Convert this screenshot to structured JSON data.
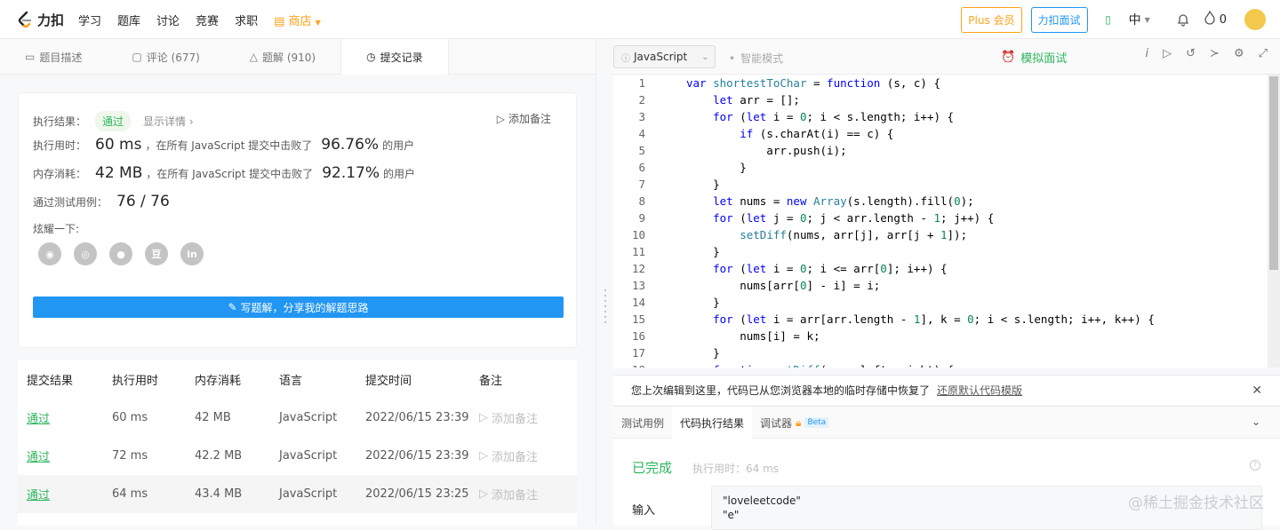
{
  "topbar": {
    "logo": "力扣",
    "nav": [
      "学习",
      "题库",
      "讨论",
      "竞赛",
      "求职"
    ],
    "shop": "商店",
    "plus_button": "Plus 会员",
    "interview_button": "力扣面试",
    "lang_switch": "中",
    "points": "0"
  },
  "left_tabs": [
    {
      "label": "题目描述"
    },
    {
      "label": "评论 (677)"
    },
    {
      "label": "题解 (910)"
    },
    {
      "label": "提交记录"
    }
  ],
  "result": {
    "label_result": "执行结果：",
    "status": "通过",
    "show_details": "显示详情",
    "add_note": "添加备注",
    "label_time": "执行用时：",
    "time_value": "60 ms",
    "time_desc": "，在所有 JavaScript 提交中击败了",
    "time_pct": "96.76%",
    "users_suffix": "的用户",
    "label_memory": "内存消耗：",
    "memory_value": "42 MB",
    "memory_desc": "，在所有 JavaScript 提交中击败了",
    "memory_pct": "92.17%",
    "label_tests": "通过测试用例：",
    "tests_value": "76 / 76",
    "share_label": "炫耀一下:",
    "write_solution": "写题解，分享我的解题思路"
  },
  "table": {
    "headers": [
      "提交结果",
      "执行用时",
      "内存消耗",
      "语言",
      "提交时间",
      "备注"
    ],
    "rows": [
      {
        "status": "通过",
        "time": "60 ms",
        "memory": "42 MB",
        "lang": "JavaScript",
        "date": "2022/06/15 23:39",
        "note": "添加备注"
      },
      {
        "status": "通过",
        "time": "72 ms",
        "memory": "42.2 MB",
        "lang": "JavaScript",
        "date": "2022/06/15 23:39",
        "note": "添加备注"
      },
      {
        "status": "通过",
        "time": "64 ms",
        "memory": "43.4 MB",
        "lang": "JavaScript",
        "date": "2022/06/15 23:25",
        "note": "添加备注"
      }
    ]
  },
  "editor": {
    "language": "JavaScript",
    "smart_mode": "智能模式",
    "mock_interview": "模拟面试",
    "lines": [
      "var shortestToChar = function (s, c) {",
      "    let arr = [];",
      "    for (let i = 0; i < s.length; i++) {",
      "        if (s.charAt(i) == c) {",
      "            arr.push(i);",
      "        }",
      "    }",
      "    let nums = new Array(s.length).fill(0);",
      "    for (let j = 0; j < arr.length - 1; j++) {",
      "        setDiff(nums, arr[j], arr[j + 1]);",
      "    }",
      "    for (let i = 0; i <= arr[0]; i++) {",
      "        nums[arr[0] - i] = i;",
      "    }",
      "    for (let i = arr[arr.length - 1], k = 0; i < s.length; i++, k++) {",
      "        nums[i] = k;",
      "    }",
      "    function setDiff(arr, left, right) {"
    ]
  },
  "restore": {
    "message": "您上次编辑到这里，代码已从您浏览器本地的临时存储中恢复了",
    "link": "还原默认代码模版"
  },
  "bottom_tabs": [
    "测试用例",
    "代码执行结果",
    "调试器",
    "Beta"
  ],
  "console": {
    "status": "已完成",
    "exec_time": "执行用时：64 ms",
    "input_label": "输入",
    "input_lines": [
      "\"loveleetcode\"",
      "\"e\""
    ]
  },
  "watermark": "@稀土掘金技术社区",
  "colors": {
    "accent": "#2196f3",
    "success": "#2db55d",
    "brand": "#ffa116"
  }
}
